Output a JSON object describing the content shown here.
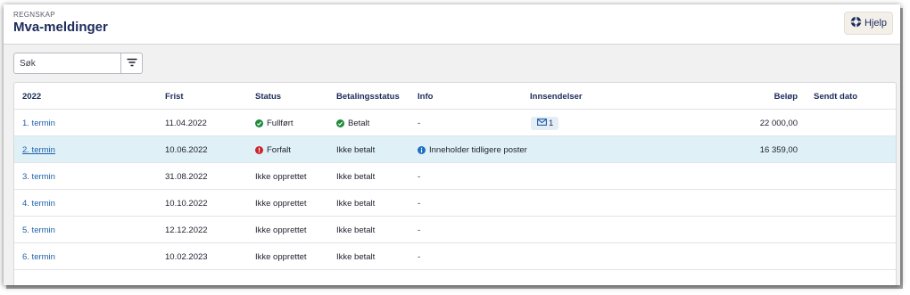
{
  "header": {
    "kicker": "REGNSKAP",
    "title": "Mva-meldinger",
    "help_label": "Hjelp"
  },
  "toolbar": {
    "search_placeholder": "Søk"
  },
  "table": {
    "columns": {
      "year": "2022",
      "frist": "Frist",
      "status": "Status",
      "betalingsstatus": "Betalingsstatus",
      "info": "Info",
      "innsendelser": "Innsendelser",
      "belop": "Beløp",
      "sendt_dato": "Sendt dato"
    },
    "rows": [
      {
        "termin": "1. termin",
        "frist": "11.04.2022",
        "status": "Fullført",
        "status_icon": "check-circle-icon",
        "betalingsstatus": "Betalt",
        "betaling_icon": "check-circle-icon",
        "info": "-",
        "innsendelser": "1",
        "belop": "22 000,00",
        "sendt_dato": ""
      },
      {
        "termin": "2. termin",
        "frist": "10.06.2022",
        "status": "Forfalt",
        "status_icon": "error-circle-icon",
        "betalingsstatus": "Ikke betalt",
        "info": "Inneholder tidligere poster",
        "info_icon": "info-circle-icon",
        "innsendelser": "",
        "belop": "16 359,00",
        "sendt_dato": ""
      },
      {
        "termin": "3. termin",
        "frist": "31.08.2022",
        "status": "Ikke opprettet",
        "betalingsstatus": "Ikke betalt",
        "info": "-",
        "innsendelser": "",
        "belop": "",
        "sendt_dato": ""
      },
      {
        "termin": "4. termin",
        "frist": "10.10.2022",
        "status": "Ikke opprettet",
        "betalingsstatus": "Ikke betalt",
        "info": "-",
        "innsendelser": "",
        "belop": "",
        "sendt_dato": ""
      },
      {
        "termin": "5. termin",
        "frist": "12.12.2022",
        "status": "Ikke opprettet",
        "betalingsstatus": "Ikke betalt",
        "info": "-",
        "innsendelser": "",
        "belop": "",
        "sendt_dato": ""
      },
      {
        "termin": "6. termin",
        "frist": "10.02.2023",
        "status": "Ikke opprettet",
        "betalingsstatus": "Ikke betalt",
        "info": "-",
        "innsendelser": "",
        "belop": "",
        "sendt_dato": ""
      }
    ]
  },
  "colors": {
    "success": "#1f8a3a",
    "error": "#c8282d",
    "info": "#1f6fc2",
    "link": "#1f5fa8",
    "highlight_row": "#e0f0f7"
  }
}
